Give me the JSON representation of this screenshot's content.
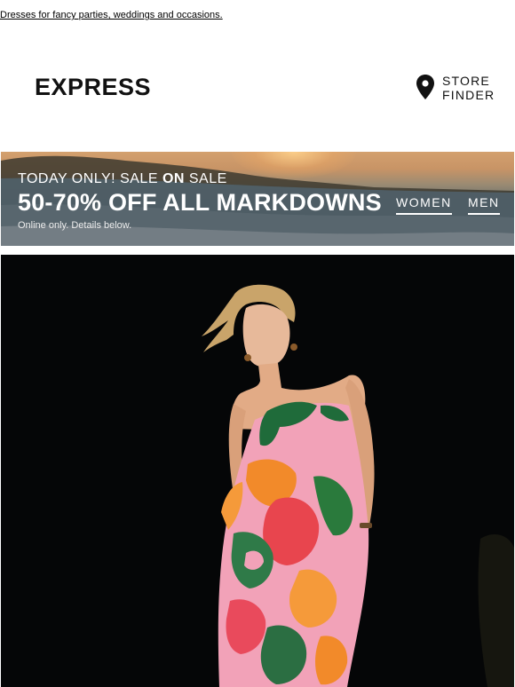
{
  "preheader": {
    "text": "Dresses for fancy parties, weddings and occasions."
  },
  "header": {
    "logo": "EXPRESS",
    "store_finder": {
      "line1": "STORE",
      "line2": "FINDER",
      "icon": "location-pin-icon"
    }
  },
  "banner": {
    "top_line_prefix": "TODAY ONLY! SALE ",
    "top_line_bold": "ON",
    "top_line_suffix": " SALE",
    "headline": "50-70% OFF ALL MARKDOWNS",
    "subtext": "Online only. Details below.",
    "nav": [
      "WOMEN",
      "MEN"
    ]
  },
  "hero": {
    "description_image": "model-in-floral-strapless-dress"
  },
  "colors": {
    "text": "#111111",
    "hero_background": "#050607",
    "banner_text": "#ffffff"
  }
}
